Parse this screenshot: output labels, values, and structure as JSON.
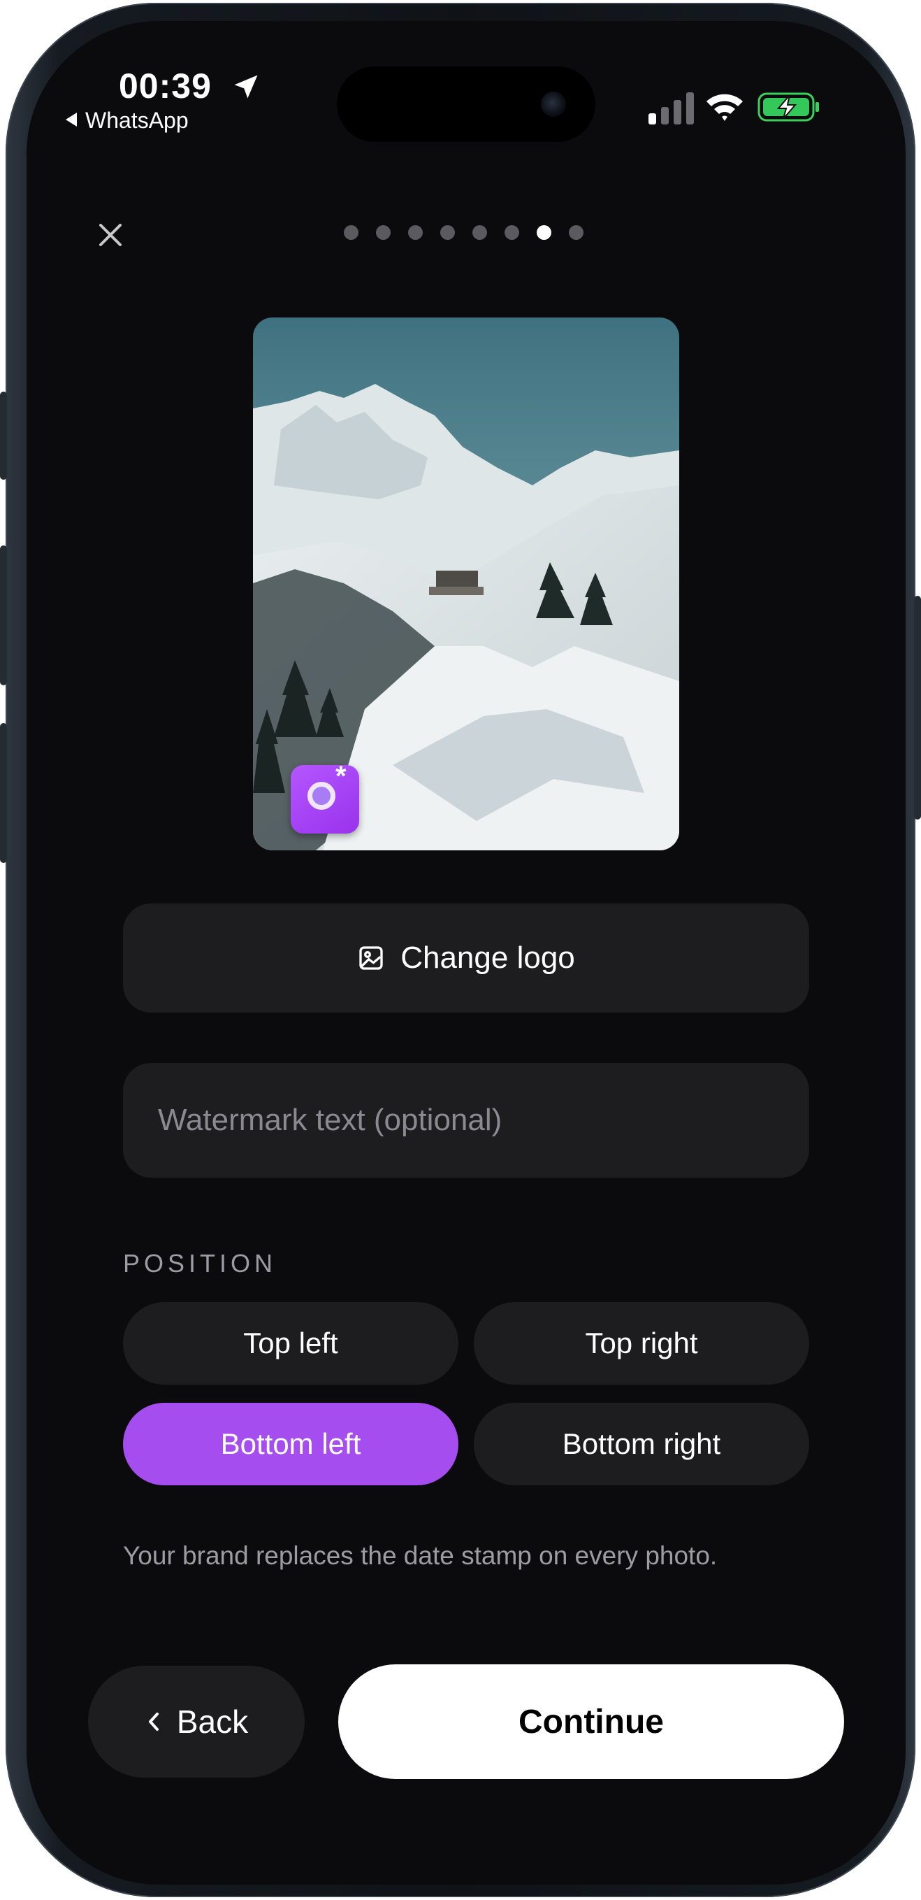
{
  "status_bar": {
    "time": "00:39",
    "back_app": "WhatsApp",
    "icons": [
      "location-arrow-icon",
      "cellular-signal-icon",
      "wifi-icon",
      "battery-charging-icon"
    ]
  },
  "header": {
    "close_icon": "close-icon",
    "steps_total": 8,
    "steps_current": 7
  },
  "preview": {
    "logo_icon": "camera-lens-sparkle-icon",
    "logo_color": "#a64df0"
  },
  "actions": {
    "change_logo_label": "Change logo",
    "change_logo_icon": "image-icon"
  },
  "watermark": {
    "placeholder": "Watermark text (optional)",
    "value": ""
  },
  "position": {
    "label": "POSITION",
    "options": [
      "Top left",
      "Top right",
      "Bottom left",
      "Bottom right"
    ],
    "selected": "Bottom left"
  },
  "hint": "Your brand replaces the date stamp on every photo.",
  "footer": {
    "back_label": "Back",
    "continue_label": "Continue"
  },
  "colors": {
    "accent": "#a64df0",
    "background": "#0b0b0d",
    "surface": "#1d1d20"
  }
}
